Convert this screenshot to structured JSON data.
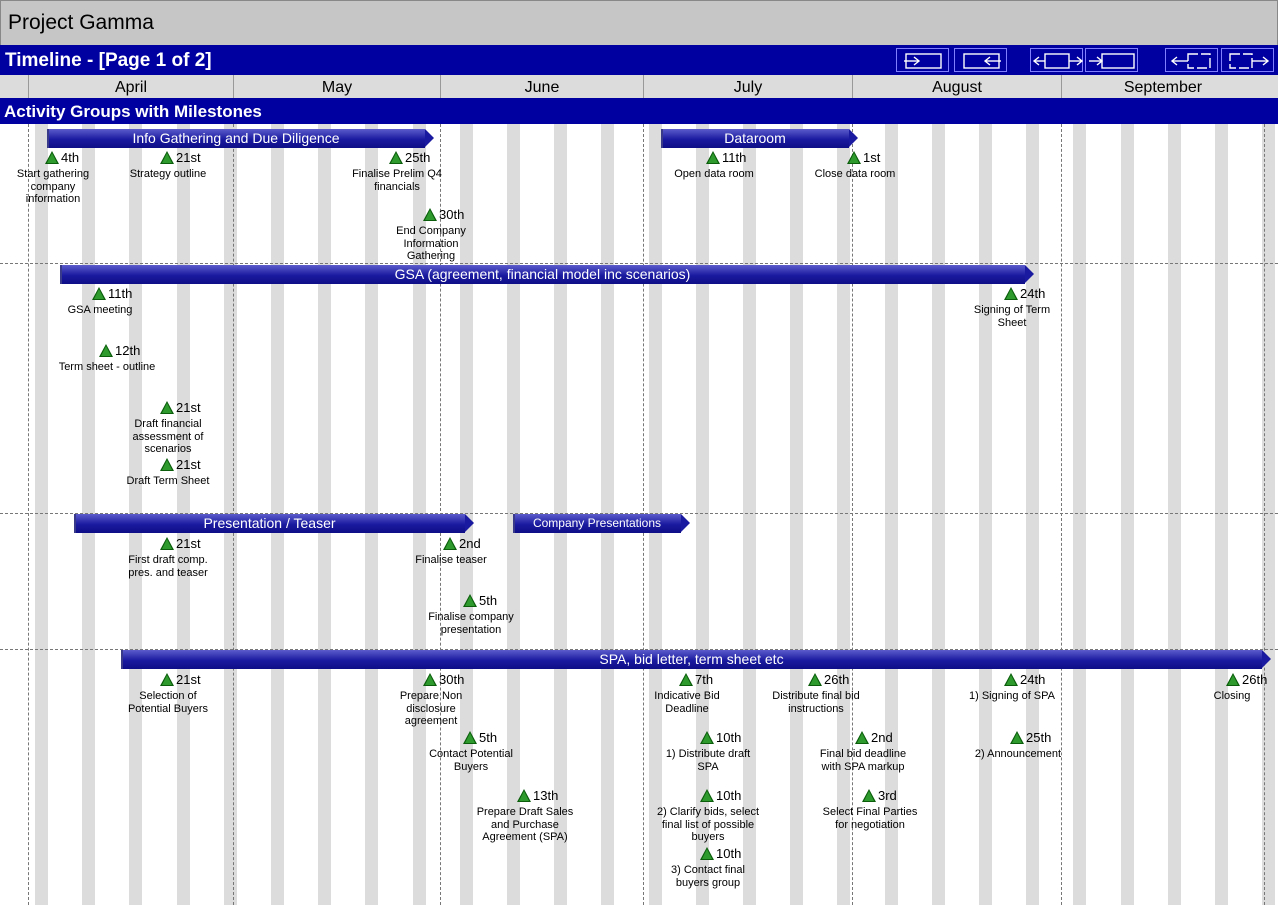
{
  "app": {
    "title": "Project Gamma"
  },
  "header": {
    "title": "Timeline - [Page 1 of 2]"
  },
  "toolbar": {
    "icons": [
      "shrink-left-icon",
      "shrink-right-icon",
      "expand-left-icon",
      "expand-right-icon",
      "scroll-left-icon",
      "scroll-right-icon"
    ]
  },
  "months": [
    "April",
    "May",
    "June",
    "July",
    "August",
    "September"
  ],
  "section": {
    "title": "Activity Groups with Milestones"
  },
  "colors": {
    "header_bg": "#0000a0",
    "bar": "#1a1aa0",
    "milestone": "#2e9a2e",
    "stripe": "#dcdcdc"
  },
  "groups": [
    {
      "bars": [
        {
          "label": "Info Gathering and Due Diligence"
        },
        {
          "label": "Dataroom"
        }
      ],
      "milestones": [
        {
          "date": "4th",
          "desc": "Start gathering company information"
        },
        {
          "date": "21st",
          "desc": "Strategy outline"
        },
        {
          "date": "25th",
          "desc": "Finalise Prelim Q4 financials"
        },
        {
          "date": "30th",
          "desc": "End Company Information Gathering"
        },
        {
          "date": "11th",
          "desc": "Open data room"
        },
        {
          "date": "1st",
          "desc": "Close data room"
        }
      ]
    },
    {
      "bars": [
        {
          "label": "GSA (agreement, financial model inc scenarios)"
        }
      ],
      "milestones": [
        {
          "date": "11th",
          "desc": "GSA meeting"
        },
        {
          "date": "12th",
          "desc": "Term sheet - outline"
        },
        {
          "date": "21st",
          "desc": "Draft financial assessment of scenarios"
        },
        {
          "date": "21st",
          "desc": "Draft Term Sheet"
        },
        {
          "date": "24th",
          "desc": "Signing of Term Sheet"
        }
      ]
    },
    {
      "bars": [
        {
          "label": "Presentation / Teaser"
        },
        {
          "label": "Company Presentations"
        }
      ],
      "milestones": [
        {
          "date": "21st",
          "desc": "First draft comp. pres. and teaser"
        },
        {
          "date": "2nd",
          "desc": "Finalise teaser"
        },
        {
          "date": "5th",
          "desc": "Finalise company presentation"
        }
      ]
    },
    {
      "bars": [
        {
          "label": "SPA, bid letter, term sheet etc"
        }
      ],
      "milestones": [
        {
          "date": "21st",
          "desc": "Selection of Potential Buyers"
        },
        {
          "date": "30th",
          "desc": "Prepare Non disclosure agreement"
        },
        {
          "date": "5th",
          "desc": "Contact Potential Buyers"
        },
        {
          "date": "13th",
          "desc": "Prepare Draft Sales and Purchase Agreement (SPA)"
        },
        {
          "date": "7th",
          "desc": "Indicative Bid Deadline"
        },
        {
          "date": "10th",
          "desc": "1) Distribute draft SPA"
        },
        {
          "date": "10th",
          "desc": "2) Clarify bids, select final list of possible buyers"
        },
        {
          "date": "10th",
          "desc": "3) Contact final buyers group"
        },
        {
          "date": "26th",
          "desc": "Distribute final bid instructions"
        },
        {
          "date": "2nd",
          "desc": "Final bid deadline with SPA markup"
        },
        {
          "date": "3rd",
          "desc": "Select Final Parties for negotiation"
        },
        {
          "date": "24th",
          "desc": "1) Signing of SPA"
        },
        {
          "date": "25th",
          "desc": "2) Announcement"
        },
        {
          "date": "26th",
          "desc": "Closing"
        }
      ]
    }
  ]
}
